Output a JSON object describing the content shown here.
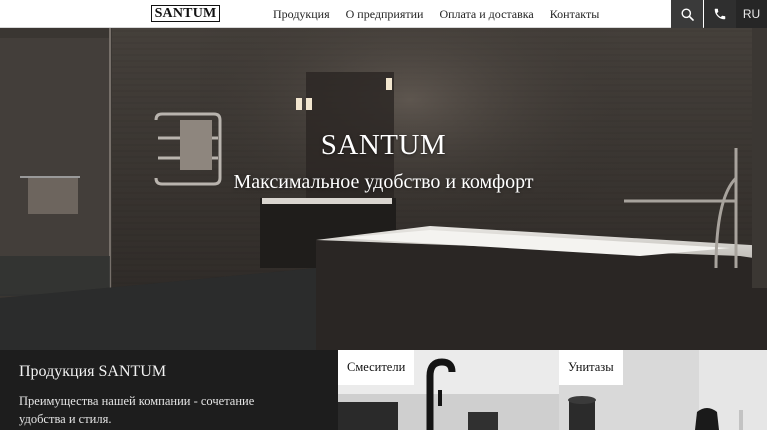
{
  "header": {
    "logo": "SANTUM",
    "nav": [
      "Продукция",
      "О предприятии",
      "Оплата и доставка",
      "Контакты"
    ],
    "search_icon": "search-icon",
    "phone_icon": "phone-icon",
    "language": "RU"
  },
  "hero": {
    "title": "SANTUM",
    "subtitle": "Максимальное удобство и комфорт"
  },
  "products": {
    "title": "Продукция SANTUM",
    "description": "Преимущества нашей компании - сочетание удобства и стиля.",
    "cards": [
      {
        "label": "Смесители"
      },
      {
        "label": "Унитазы"
      }
    ]
  }
}
